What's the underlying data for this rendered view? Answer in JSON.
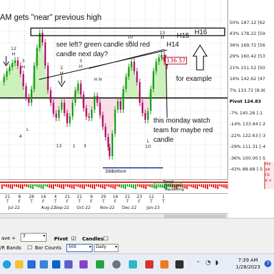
{
  "header": {
    "title_fragment": "AM gets \"near\" previous high"
  },
  "annotations": {
    "h16": "H16",
    "h15": "H15",
    "h14": "H14",
    "see_left": "see left? green candle sold red candle next day?",
    "for_example": "for example",
    "monday_note": "this monday watch team for maybe red candle",
    "price_marker": "136.57"
  },
  "price_axis": {
    "labels": [
      {
        "text": "50% 187.12 [62",
        "pivot": false
      },
      {
        "text": "43% 178.22 [59",
        "pivot": false
      },
      {
        "text": "36% 169.72 [56",
        "pivot": false
      },
      {
        "text": "29% 160.42 [53",
        "pivot": false
      },
      {
        "text": "21% 151.52 [50",
        "pivot": false
      },
      {
        "text": "14% 142.62 [47",
        "pivot": false
      },
      {
        "text": "7% 133.72 [8.9(",
        "pivot": false
      },
      {
        "text": "Pivot 124.83",
        "pivot": true
      },
      {
        "text": "-7% 145.26 [-1",
        "pivot": false
      },
      {
        "text": "-14% 133.94 [-2",
        "pivot": false
      },
      {
        "text": "-22% 122.63 [-3",
        "pivot": false
      },
      {
        "text": "-29% 111.31 [-4",
        "pivot": false
      },
      {
        "text": "-36% 100.00 [-5",
        "pivot": false
      },
      {
        "text": "-43% 88.68 [-5",
        "pivot": false
      }
    ]
  },
  "bar_labels": {
    "h12": "12",
    "h12_h": "H",
    "h3": "3",
    "h3_h": "H",
    "h10": "10",
    "h10_h": "H",
    "h13": "13",
    "h13_h": "H",
    "h2": "2",
    "h2_h": "H",
    "h3b": "3",
    "h3b_h": "H",
    "l": "L",
    "l4": "4",
    "l13": "13",
    "l1": "1",
    "l3": "3",
    "l10": "10",
    "l_2": "L",
    "h_cluster": "H H"
  },
  "lower_panel": {
    "dbbottom": "DbBottom",
    "trend_label": "Trend",
    "bollinger": "Bollinger",
    "squeezing": "Squeezing"
  },
  "x_axis": {
    "day_letters": [
      "T",
      "F",
      "T",
      "F",
      "T",
      "F",
      "T",
      "F",
      "T",
      "F",
      "T",
      "F",
      "T",
      "T"
    ],
    "day_numbers": [
      "21",
      "8",
      "28",
      "16",
      "4",
      "21",
      "21",
      "9",
      "29",
      "16",
      "21",
      "23",
      "12",
      "1"
    ],
    "months": [
      "Jul-22",
      "Aug-22",
      "Sep-22",
      "Oct-22",
      "Nov-22",
      "Dec-22",
      "Jan-23"
    ]
  },
  "controls": {
    "wave_label": "ave +",
    "wave_value": "7",
    "pivot_label": "Pivot",
    "pivot_checked": "☑",
    "candles_label": "Candles",
    "candles_checked": "☐",
    "bands_label": "/R Bands",
    "bar_counts_label": "Bar Counts",
    "bar_counts_checked": "☐",
    "bars_value": "500",
    "interval_value": "Daily"
  },
  "right_panel": {
    "line1": "Ho",
    "line2": "ve",
    "line3": "ric",
    "line4": "e v"
  },
  "taskbar": {
    "time": "7:39 AM",
    "date": "1/28/2023",
    "notification_count": "3"
  },
  "colors": {
    "up_candle": "#1a9e1a",
    "down_candle": "#b0136b",
    "area_fill": "#c8f0b4",
    "resistance_box": "#000000",
    "oscillator_red": "#e8201c",
    "oscillator_green": "#1fae2a",
    "taskbar_bg": "#e8edf5"
  }
}
